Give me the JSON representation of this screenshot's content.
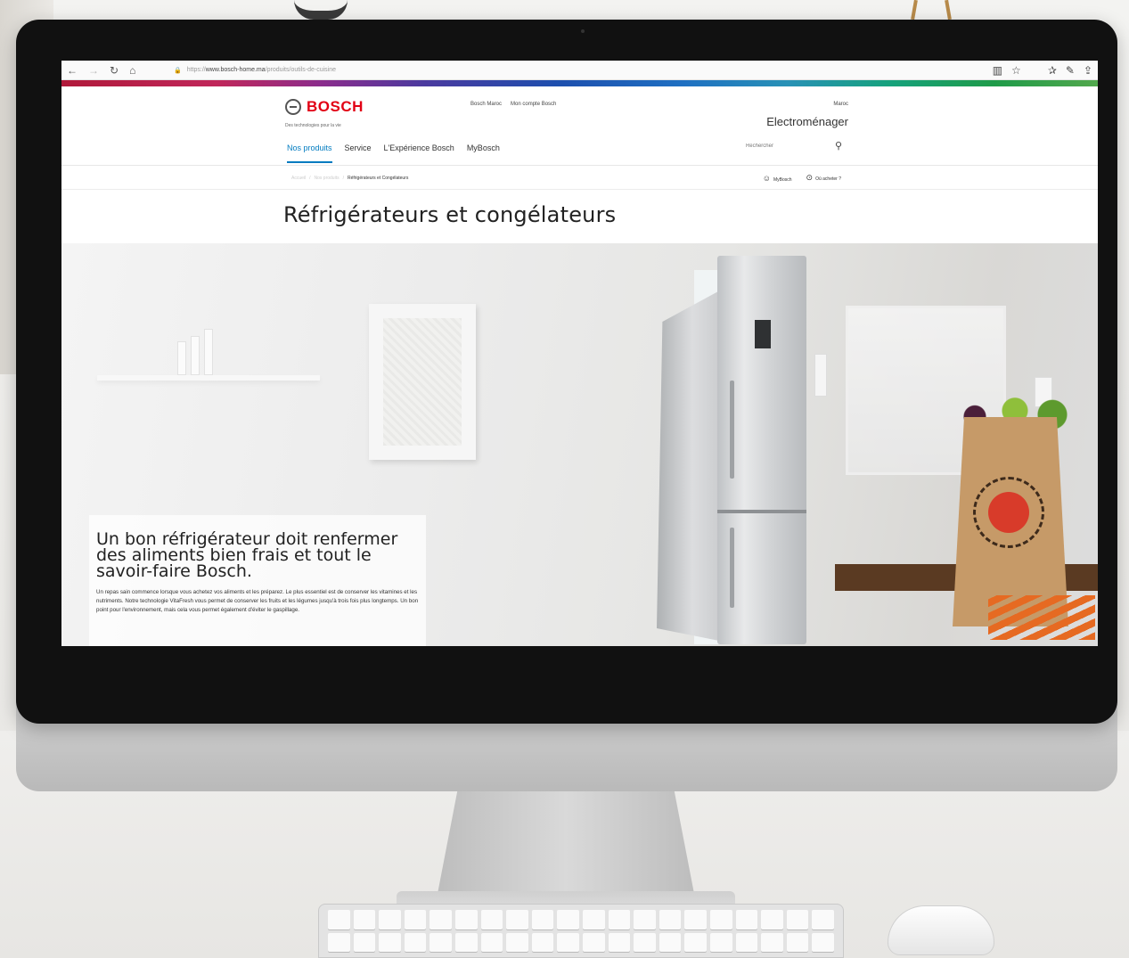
{
  "browser": {
    "url_prefix": "https://",
    "url_host": "www.bosch-home.ma",
    "url_path": "/produits/outils-de-cuisine",
    "back_icon": "←",
    "forward_icon": "→",
    "reload_icon": "↻",
    "home_icon": "⌂",
    "lock_icon": "🔒",
    "reader_icon": "▥",
    "star_icon": "☆",
    "favorites_icon": "✰",
    "pen_icon": "✎",
    "share_icon": "⇪"
  },
  "brand": {
    "name": "BOSCH",
    "tagline": "Des technologies pour la vie"
  },
  "top_links": [
    "Bosch Maroc",
    "Mon compte Bosch"
  ],
  "country": "Maroc",
  "division": "Electroménager",
  "nav": [
    "Nos produits",
    "Service",
    "L'Expérience Bosch",
    "MyBosch"
  ],
  "search": {
    "placeholder": "Rechercher",
    "icon": "⚲"
  },
  "breadcrumb": [
    "Accueil",
    "Nos produits",
    "Réfrigérateurs et Congélateurs"
  ],
  "utility": {
    "mybosch": "MyBosch",
    "where_to_buy": "Où acheter ?",
    "user_icon": "☺",
    "pin_icon": "⊙"
  },
  "page_title": "Réfrigérateurs et congélateurs",
  "hero": {
    "title": "Un bon réfrigérateur doit renfermer des aliments bien frais et tout le savoir-faire Bosch.",
    "body": "Un repas sain commence lorsque vous achetez vos aliments et les préparez. Le plus essentiel est de conserver les vitamines et les nutriments. Notre technologie VitaFresh vous permet de conserver les fruits et les légumes jusqu'à trois fois plus longtemps. Un bon point pour l'environnement, mais cela vous permet également d'éviter le gaspillage."
  },
  "colors": {
    "brand_red": "#e20015",
    "link_blue": "#007bc0"
  }
}
